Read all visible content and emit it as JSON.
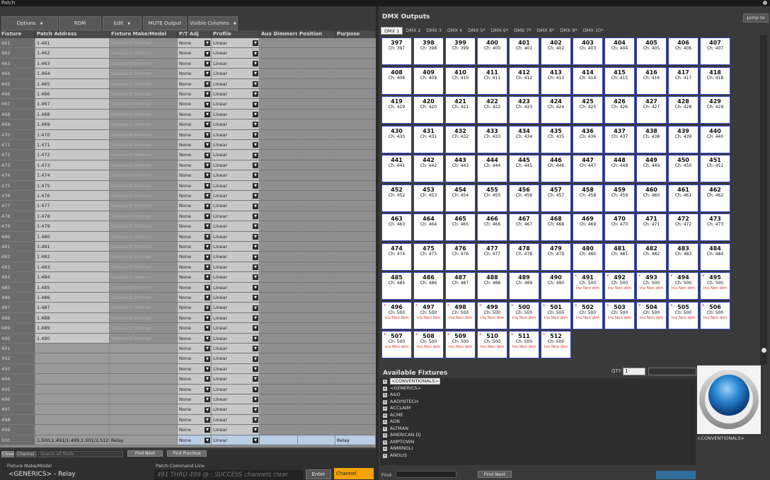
{
  "window": {
    "title": "Patch"
  },
  "toolbar": {
    "options": "Options",
    "rdm": "RDM",
    "edit": "Edit",
    "mute": "MUTE Output",
    "visible_columns": "Visible Columns"
  },
  "grid": {
    "headers": [
      "Fixture",
      "Patch Address",
      "Fixture Make/Model",
      "P/T Adj",
      "Profile",
      "Aux Dimmers",
      "Position",
      "Purpose"
    ],
    "rows": [
      [
        "461",
        "1.461",
        "Standard Dimmer",
        "None",
        "Linear",
        "",
        "",
        ""
      ],
      [
        "462",
        "1.462",
        "Standard Dimmer",
        "None",
        "Linear",
        "",
        "",
        ""
      ],
      [
        "463",
        "1.463",
        "Standard Dimmer",
        "None",
        "Linear",
        "",
        "",
        ""
      ],
      [
        "464",
        "1.464",
        "Standard Dimmer",
        "None",
        "Linear",
        "",
        "",
        ""
      ],
      [
        "465",
        "1.465",
        "Standard Dimmer",
        "None",
        "Linear",
        "",
        "",
        ""
      ],
      [
        "466",
        "1.466",
        "Standard Dimmer",
        "None",
        "Linear",
        "",
        "",
        ""
      ],
      [
        "467",
        "1.467",
        "Standard Dimmer",
        "None",
        "Linear",
        "",
        "",
        ""
      ],
      [
        "468",
        "1.468",
        "Standard Dimmer",
        "None",
        "Linear",
        "",
        "",
        ""
      ],
      [
        "469",
        "1.469",
        "Standard Dimmer",
        "None",
        "Linear",
        "",
        "",
        ""
      ],
      [
        "470",
        "1.470",
        "Standard Dimmer",
        "None",
        "Linear",
        "",
        "",
        ""
      ],
      [
        "471",
        "1.471",
        "Standard Dimmer",
        "None",
        "Linear",
        "",
        "",
        ""
      ],
      [
        "472",
        "1.472",
        "Standard Dimmer",
        "None",
        "Linear",
        "",
        "",
        ""
      ],
      [
        "473",
        "1.473",
        "Standard Dimmer",
        "None",
        "Linear",
        "",
        "",
        ""
      ],
      [
        "474",
        "1.474",
        "Standard Dimmer",
        "None",
        "Linear",
        "",
        "",
        ""
      ],
      [
        "475",
        "1.475",
        "Standard Dimmer",
        "None",
        "Linear",
        "",
        "",
        ""
      ],
      [
        "476",
        "1.476",
        "Standard Dimmer",
        "None",
        "Linear",
        "",
        "",
        ""
      ],
      [
        "477",
        "1.477",
        "Standard Dimmer",
        "None",
        "Linear",
        "",
        "",
        ""
      ],
      [
        "478",
        "1.478",
        "Standard Dimmer",
        "None",
        "Linear",
        "",
        "",
        ""
      ],
      [
        "479",
        "1.479",
        "Standard Dimmer",
        "None",
        "Linear",
        "",
        "",
        ""
      ],
      [
        "480",
        "1.480",
        "Standard Dimmer",
        "None",
        "Linear",
        "",
        "",
        ""
      ],
      [
        "481",
        "1.481",
        "Standard Dimmer",
        "None",
        "Linear",
        "",
        "",
        ""
      ],
      [
        "482",
        "1.482",
        "Standard Dimmer",
        "None",
        "Linear",
        "",
        "",
        ""
      ],
      [
        "483",
        "1.483",
        "Standard Dimmer",
        "None",
        "Linear",
        "",
        "",
        ""
      ],
      [
        "484",
        "1.484",
        "Standard Dimmer",
        "None",
        "Linear",
        "",
        "",
        ""
      ],
      [
        "485",
        "1.485",
        "Standard Dimmer",
        "None",
        "Linear",
        "",
        "",
        ""
      ],
      [
        "486",
        "1.486",
        "Standard Dimmer",
        "None",
        "Linear",
        "",
        "",
        ""
      ],
      [
        "487",
        "1.487",
        "Standard Dimmer",
        "None",
        "Linear",
        "",
        "",
        ""
      ],
      [
        "488",
        "1.488",
        "Standard Dimmer",
        "None",
        "Linear",
        "",
        "",
        ""
      ],
      [
        "489",
        "1.489",
        "Standard Dimmer",
        "None",
        "Linear",
        "",
        "",
        ""
      ],
      [
        "490",
        "1.490",
        "Standard Dimmer",
        "None",
        "Linear",
        "",
        "",
        ""
      ],
      [
        "491",
        "",
        "",
        "None",
        "Linear",
        "",
        "",
        ""
      ],
      [
        "492",
        "",
        "",
        "None",
        "Linear",
        "",
        "",
        ""
      ],
      [
        "493",
        "",
        "",
        "None",
        "Linear",
        "",
        "",
        ""
      ],
      [
        "494",
        "",
        "",
        "None",
        "Linear",
        "",
        "",
        ""
      ],
      [
        "495",
        "",
        "",
        "None",
        "Linear",
        "",
        "",
        ""
      ],
      [
        "496",
        "",
        "",
        "None",
        "Linear",
        "",
        "",
        ""
      ],
      [
        "497",
        "",
        "",
        "None",
        "Linear",
        "",
        "",
        ""
      ],
      [
        "498",
        "",
        "",
        "None",
        "Linear",
        "",
        "",
        ""
      ],
      [
        "499",
        "",
        "",
        "None",
        "Linear",
        "",
        "",
        ""
      ],
      [
        "500",
        "1.500,1.491/1.499,1.501/1.512",
        "Relay",
        "None",
        "Linear",
        "",
        "",
        "Relay"
      ]
    ]
  },
  "bottom": {
    "close": "Close",
    "channel": "Channel",
    "search_placeholder": "Search all fields",
    "find_next": "Find Next",
    "find_previous": "Find Previous",
    "fixture_label": "Fixture Make/Model",
    "fixture_value": "<GENERICS> - Relay",
    "cmd_label": "Patch Command Line",
    "cmd_value": "491 THRU 499 @ : SUCCESS channels clear",
    "enter": "Enter",
    "channel_btn": "Channel"
  },
  "dmx": {
    "title": "DMX Outputs",
    "jump": "Jump to",
    "tabs": [
      "DMX 1",
      "DMX 2",
      "DMX 3",
      "DMX 4",
      "DMX 5*",
      "DMX 6*",
      "DMX 7*",
      "DMX 8*",
      "DMX 9*",
      "DMX 10*"
    ],
    "inv_label": "Inv Non dim"
  },
  "available": {
    "title": "Available Fixtures",
    "qty_label": "QTY",
    "qty_value": "1",
    "items": [
      "<CONVENTIONALS>",
      "<GENERICS>",
      "A&O",
      "AADYNTECH",
      "ACCLAIM",
      "ACME",
      "ADB",
      "ALTMAN",
      "AMERICAN DJ",
      "AMPTOWN",
      "ANMINGLI",
      "ANOLIS"
    ],
    "preview_label": "<CONVENTIONALS>",
    "find_label": "Find:",
    "find_next": "Find Next"
  },
  "colors": {
    "accent": "#3747c6",
    "warn": "#d52a2a",
    "channel_btn": "#f4a300"
  }
}
